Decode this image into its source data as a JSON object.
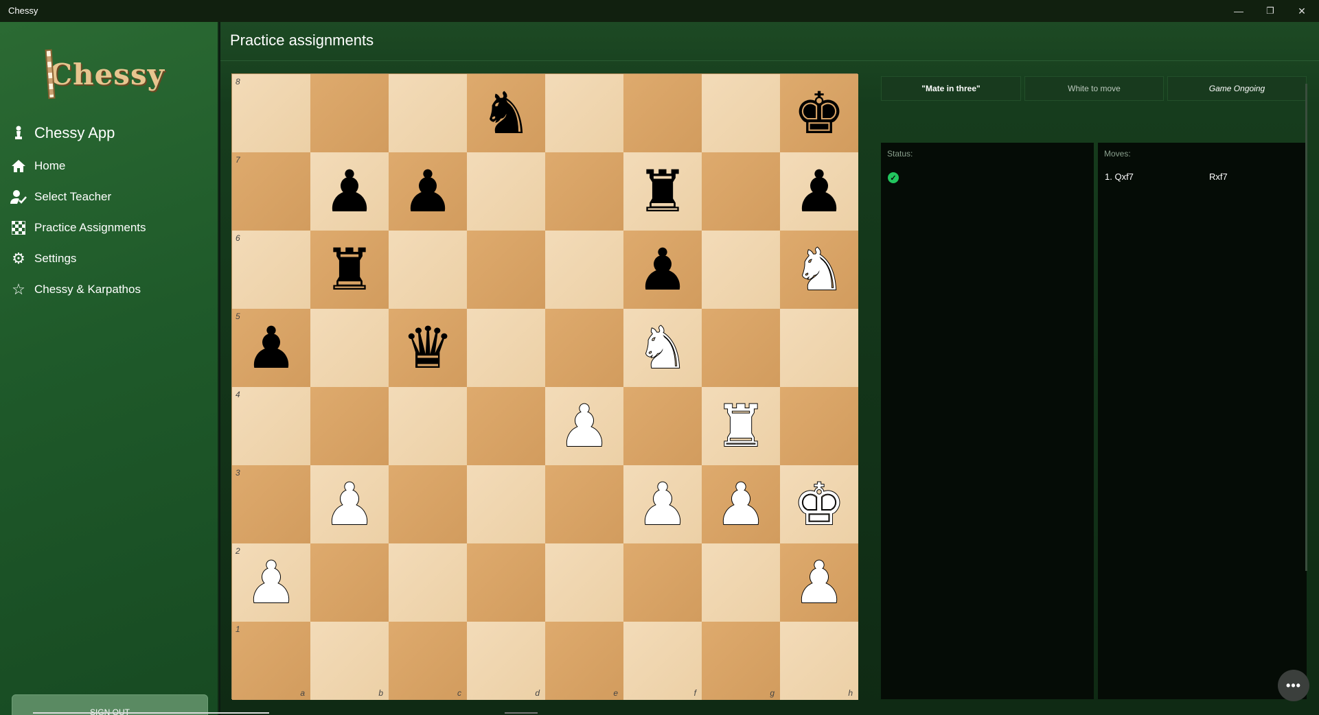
{
  "window": {
    "title": "Chessy",
    "minimize": "—",
    "restore": "❐",
    "close": "✕"
  },
  "sidebar": {
    "logo_text": "Chessy",
    "app_name": "Chessy App",
    "items": [
      {
        "label": "Home",
        "icon": "home-icon"
      },
      {
        "label": "Select Teacher",
        "icon": "user-check-icon"
      },
      {
        "label": "Practice Assignments",
        "icon": "checkerboard-icon"
      },
      {
        "label": "Settings",
        "icon": "gear-icon"
      },
      {
        "label": "Chessy & Karpathos",
        "icon": "star-icon"
      }
    ],
    "signout_label": "SIGN OUT"
  },
  "main": {
    "title": "Practice assignments",
    "tabs": [
      {
        "label": "\"Mate in three\""
      },
      {
        "label": "White to move"
      },
      {
        "label": "Game Ongoing"
      }
    ],
    "status_panel": {
      "header": "Status:",
      "icon": "check-circle-icon"
    },
    "moves_panel": {
      "header": "Moves:",
      "moves": [
        {
          "number": "1. Qxf7",
          "black": "Rxf7"
        }
      ]
    },
    "more_button": "•••"
  },
  "board": {
    "files": [
      "a",
      "b",
      "c",
      "d",
      "e",
      "f",
      "g",
      "h"
    ],
    "ranks": [
      "8",
      "7",
      "6",
      "5",
      "4",
      "3",
      "2",
      "1"
    ],
    "pieces": {
      "d8": "bN",
      "h8": "bK",
      "b7": "bP",
      "c7": "bP",
      "f7": "bR",
      "h7": "bP",
      "b6": "bR",
      "f6": "bP",
      "h6": "wN",
      "a5": "bP",
      "c5": "bQ",
      "f5": "wN",
      "e4": "wP",
      "g4": "wR",
      "b3": "wP",
      "f3": "wP",
      "g3": "wP",
      "h3": "wK",
      "a2": "wP",
      "h2": "wP"
    }
  },
  "colors": {
    "sidebar": "#1f5a2a",
    "light_square": "#f3dbb8",
    "dark_square": "#d9a464",
    "status_ok": "#22c55e"
  }
}
